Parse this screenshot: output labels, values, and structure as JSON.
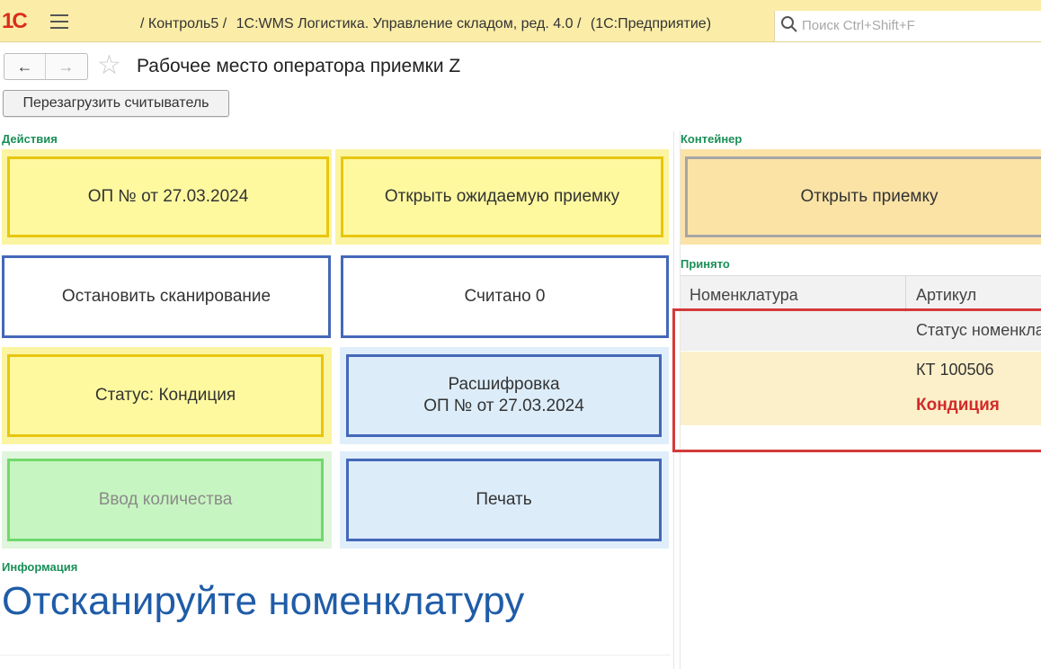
{
  "topbar": {
    "logo": "1С",
    "breadcrumb": [
      "/ Контроль5 /",
      "1С:WMS Логистика. Управление складом, ред. 4.0 /",
      "(1С:Предприятие)"
    ],
    "search_placeholder": "Поиск Ctrl+Shift+F"
  },
  "nav": {
    "back": "←",
    "forward": "→",
    "star": "☆"
  },
  "page_title": "Рабочее место оператора приемки Z",
  "reload_button": "Перезагрузить считыватель",
  "actions": {
    "label": "Действия",
    "op_button": "ОП №  от 27.03.2024",
    "open_expected": "Открыть ожидаемую приемку",
    "stop_scan": "Остановить сканирование",
    "read_count": "Считано 0",
    "status": "Статус: Кондиция",
    "decode_line1": "Расшифровка",
    "decode_line2": "ОП №  от 27.03.2024",
    "qty_input": "Ввод количества",
    "print": "Печать"
  },
  "info": {
    "label": "Информация",
    "message": "Отсканируйте номенклатуру"
  },
  "container": {
    "label": "Контейнер",
    "open_receipt": "Открыть приемку"
  },
  "accepted": {
    "label": "Принято",
    "columns": [
      "Номенклатура",
      "Артикул"
    ],
    "subheader": "Статус номенклатуры",
    "rows": [
      {
        "sku": "КТ 100506",
        "status": "Кондиция"
      }
    ]
  },
  "colors": {
    "topbar_bg": "#fbeda7",
    "group_label": "#1a8f57",
    "info_text": "#1f5ca8",
    "status_red": "#d32a2a",
    "highlight": "#d43a3a"
  }
}
